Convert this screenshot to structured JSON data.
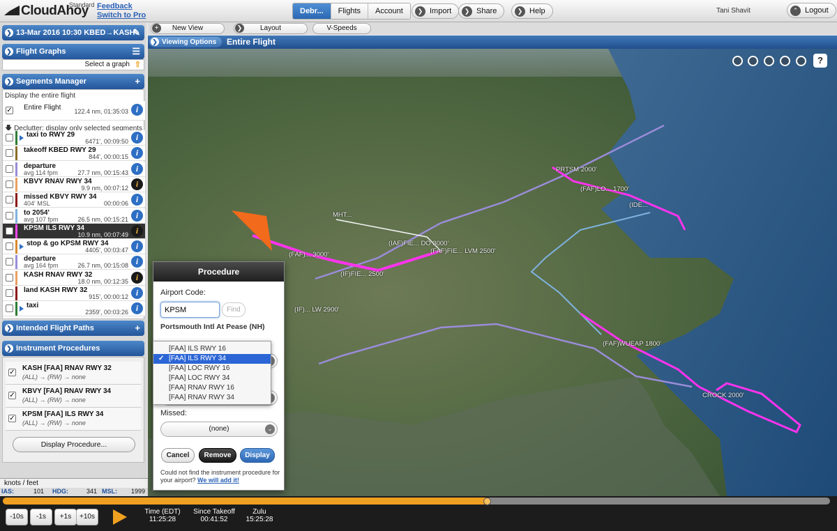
{
  "app": {
    "logo": "CloudAhoy",
    "tier": "Standard",
    "feedback": "Feedback",
    "switch_pro": "Switch to Pro",
    "user": "Tani Shavit"
  },
  "nav": {
    "tabs": [
      "Debr...",
      "Flights",
      "Account"
    ],
    "import": "Import",
    "share": "Share",
    "help": "Help",
    "logout": "Logout"
  },
  "flight": {
    "title": "13-Mar 2016 10:30   KBED→KASH"
  },
  "graphs": {
    "header": "Flight Graphs",
    "select": "Select a graph"
  },
  "segments": {
    "header": "Segments Manager",
    "display_entire": "Display the entire flight",
    "entire": {
      "name": "Entire Flight",
      "value": "122.4 nm, 01:35:03"
    },
    "declutter": "Declutter: display only selected segments",
    "items": [
      {
        "name": "taxi to RWY 29",
        "sub": "",
        "value": "6471', 00:09:50",
        "color": "#2e7d32",
        "icon": "play-icon",
        "info": "info"
      },
      {
        "name": "takeoff KBED RWY 29",
        "sub": "",
        "value": "844', 00:00:15",
        "color": "#8a6d2a",
        "info": "info"
      },
      {
        "name": "departure",
        "sub": "avg 114 fpm",
        "value": "27.7 nm, 00:15:43",
        "color": "#9a8cd8",
        "info": "info"
      },
      {
        "name": "KBVY RNAV RWY 34",
        "sub": "",
        "value": "9.9 nm, 00:07:12",
        "color": "#e8a060",
        "info": "warn"
      },
      {
        "name": "missed KBVY RWY 34",
        "sub": "404' MSL",
        "value": "00:00:06",
        "color": "#8b1a1a",
        "info": "info"
      },
      {
        "name": "to 2054'",
        "sub": "avg 107 fpm",
        "value": "26.5 nm, 00:15:21",
        "color": "#7fb3e0",
        "info": "info"
      },
      {
        "name": "KPSM ILS RWY 34",
        "sub": "",
        "value": "10.9 nm, 00:07:49",
        "color": "#ff44ee",
        "info": "warn",
        "selected": true
      },
      {
        "name": "stop & go KPSM RWY 34",
        "sub": "",
        "value": "4405', 00:03:47",
        "color": "#d88a30",
        "icon": "play-icon",
        "info": "info"
      },
      {
        "name": "departure",
        "sub": "avg 164 fpm",
        "value": "26.7 nm, 00:15:08",
        "color": "#9a8cd8",
        "info": "info"
      },
      {
        "name": "KASH RNAV RWY 32",
        "sub": "",
        "value": "18.0 nm, 00:12:35",
        "color": "#e8a060",
        "info": "warn"
      },
      {
        "name": "land KASH RWY 32",
        "sub": "",
        "value": "915', 00:00:12",
        "color": "#8b1a1a",
        "info": "info"
      },
      {
        "name": "taxi",
        "sub": "",
        "value": "2359', 00:03:26",
        "color": "#2e7d32",
        "icon": "play-icon",
        "info": "info"
      }
    ]
  },
  "intended": {
    "header": "Intended Flight Paths"
  },
  "procedures": {
    "header": "Instrument Procedures",
    "items": [
      {
        "name": "KASH [FAA] RNAV RWY 32",
        "sub": "(ALL) → (RW) → none"
      },
      {
        "name": "KBVY [FAA] RNAV RWY 34",
        "sub": "(ALL) → (RW) → none"
      },
      {
        "name": "KPSM [FAA] ILS RWY 34",
        "sub": "(ALL) → (RW) → none"
      }
    ],
    "display_btn": "Display Procedure..."
  },
  "status": {
    "units": "knots / feet",
    "ias_label": "IAS:",
    "ias": "101",
    "hdg_label": "HDG:",
    "hdg": "341",
    "msl_label": "MSL:",
    "msl": "1999"
  },
  "toolbar": {
    "new_view": "New View",
    "layout": "Layout",
    "vspeeds": "V-Speeds",
    "viewing_options": "Viewing Options",
    "view_title": "Entire Flight"
  },
  "map_labels": [
    "PRTSM 2000'",
    "(FAF)LO... 1700'",
    "(IDE...",
    "MHT...",
    "(IAF)FIE... DO 3000'",
    "(FAF)FIE... LVM 2500'",
    "(IF)FIE... 2500'",
    "(FAF)... 3000'",
    "(IF)... LW 2900'",
    "(FAF)WUEAP 1800'",
    "CROCK 2000'"
  ],
  "dialog": {
    "title": "Procedure",
    "airport_label": "Airport Code:",
    "airport_value": "KPSM",
    "find": "Find",
    "airport_name": "Portsmouth Intl At Pease (NH)",
    "options": [
      "[FAA] ILS RWY 16",
      "[FAA] ILS RWY 34",
      "[FAA] LOC RWY 16",
      "[FAA] LOC RWY 34",
      "[FAA] RNAV RWY 16",
      "[FAA] RNAV RWY 34"
    ],
    "selected_index": 1,
    "missed_label": "Missed:",
    "missed_value": "(none)",
    "cancel": "Cancel",
    "remove": "Remove",
    "display": "Display",
    "footer": "Could not find the instrument procedure for your airport?",
    "footer_link": "We will add it!"
  },
  "playback": {
    "steps": [
      "-10s",
      "-1s",
      "+1s",
      "+10s"
    ],
    "time_label": "Time (EDT)",
    "time": "11:25:28",
    "since_label": "Since Takeoff",
    "since": "00:41:52",
    "zulu_label": "Zulu",
    "zulu": "15:25:28",
    "progress": 0.585
  },
  "colors": {
    "accent": "#2c68b3",
    "route_magenta": "#ff33ee",
    "arrow_orange": "#f26a1b",
    "timeline": "#f0a020"
  }
}
